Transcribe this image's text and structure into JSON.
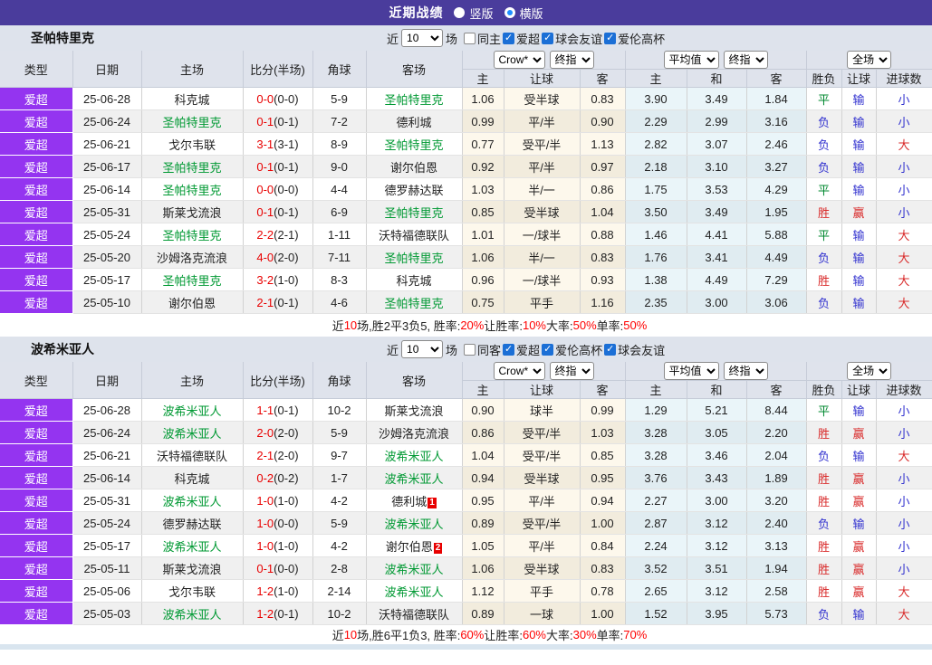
{
  "topbar": {
    "title": "近期战绩",
    "layout_options": [
      {
        "label": "竖版",
        "selected": false
      },
      {
        "label": "横版",
        "selected": true
      }
    ]
  },
  "colors": {
    "topbar": "#4a3c9c",
    "league_badge": "#9434f0",
    "focal_team": "#009933",
    "score_fulltime": "#e80000",
    "win_text": "#d92b2b",
    "draw_text": "#00882f",
    "lose_text": "#3232cf",
    "summary_highlight": "#ff0000",
    "crow_col_bg": "#fdf8ec",
    "avg_col_bg": "#eaf5f9"
  },
  "table_header": {
    "type": "类型",
    "date": "日期",
    "home": "主场",
    "score": "比分(半场)",
    "corner": "角球",
    "away": "客场",
    "crow_select": "Crow*",
    "final_select": "终指",
    "avg_select": "平均值",
    "final_select2": "终指",
    "full_select": "全场",
    "sub_home": "主",
    "sub_handicap": "让球",
    "sub_away": "客",
    "sub_avg_home": "主",
    "sub_draw": "和",
    "sub_avg_away": "客",
    "sub_result": "胜负",
    "sub_handicap_result": "让球",
    "sub_goals": "进球数"
  },
  "sections": [
    {
      "team": "圣帕特里克",
      "controls": {
        "near_label": "近",
        "count": "10",
        "games_label": "场",
        "checkboxes": [
          {
            "label": "同主",
            "checked": false
          },
          {
            "label": "爱超",
            "checked": true
          },
          {
            "label": "球会友谊",
            "checked": true
          },
          {
            "label": "爱伦高杯",
            "checked": true
          }
        ]
      },
      "rows": [
        {
          "league": "爱超",
          "date": "25-06-28",
          "home": "科克城",
          "home_focal": false,
          "score": "0-0",
          "half": "(0-0)",
          "corner": "5-9",
          "away": "圣帕特里克",
          "away_focal": true,
          "crow": [
            "1.06",
            "受半球",
            "0.83"
          ],
          "avg": [
            "3.90",
            "3.49",
            "1.84"
          ],
          "full": [
            "平",
            "输",
            "小"
          ]
        },
        {
          "league": "爱超",
          "date": "25-06-24",
          "home": "圣帕特里克",
          "home_focal": true,
          "score": "0-1",
          "half": "(0-1)",
          "corner": "7-2",
          "away": "德利城",
          "away_focal": false,
          "crow": [
            "0.99",
            "平/半",
            "0.90"
          ],
          "avg": [
            "2.29",
            "2.99",
            "3.16"
          ],
          "full": [
            "负",
            "输",
            "小"
          ]
        },
        {
          "league": "爱超",
          "date": "25-06-21",
          "home": "戈尔韦联",
          "home_focal": false,
          "score": "3-1",
          "half": "(3-1)",
          "corner": "8-9",
          "away": "圣帕特里克",
          "away_focal": true,
          "crow": [
            "0.77",
            "受平/半",
            "1.13"
          ],
          "avg": [
            "2.82",
            "3.07",
            "2.46"
          ],
          "full": [
            "负",
            "输",
            "大"
          ]
        },
        {
          "league": "爱超",
          "date": "25-06-17",
          "home": "圣帕特里克",
          "home_focal": true,
          "score": "0-1",
          "half": "(0-1)",
          "corner": "9-0",
          "away": "谢尔伯恩",
          "away_focal": false,
          "crow": [
            "0.92",
            "平/半",
            "0.97"
          ],
          "avg": [
            "2.18",
            "3.10",
            "3.27"
          ],
          "full": [
            "负",
            "输",
            "小"
          ]
        },
        {
          "league": "爱超",
          "date": "25-06-14",
          "home": "圣帕特里克",
          "home_focal": true,
          "score": "0-0",
          "half": "(0-0)",
          "corner": "4-4",
          "away": "德罗赫达联",
          "away_focal": false,
          "crow": [
            "1.03",
            "半/一",
            "0.86"
          ],
          "avg": [
            "1.75",
            "3.53",
            "4.29"
          ],
          "full": [
            "平",
            "输",
            "小"
          ]
        },
        {
          "league": "爱超",
          "date": "25-05-31",
          "home": "斯莱戈流浪",
          "home_focal": false,
          "score": "0-1",
          "half": "(0-1)",
          "corner": "6-9",
          "away": "圣帕特里克",
          "away_focal": true,
          "crow": [
            "0.85",
            "受半球",
            "1.04"
          ],
          "avg": [
            "3.50",
            "3.49",
            "1.95"
          ],
          "full": [
            "胜",
            "赢",
            "小"
          ]
        },
        {
          "league": "爱超",
          "date": "25-05-24",
          "home": "圣帕特里克",
          "home_focal": true,
          "score": "2-2",
          "half": "(2-1)",
          "corner": "1-11",
          "away": "沃特福德联队",
          "away_focal": false,
          "crow": [
            "1.01",
            "一/球半",
            "0.88"
          ],
          "avg": [
            "1.46",
            "4.41",
            "5.88"
          ],
          "full": [
            "平",
            "输",
            "大"
          ]
        },
        {
          "league": "爱超",
          "date": "25-05-20",
          "home": "沙姆洛克流浪",
          "home_focal": false,
          "score": "4-0",
          "half": "(2-0)",
          "corner": "7-11",
          "away": "圣帕特里克",
          "away_focal": true,
          "crow": [
            "1.06",
            "半/一",
            "0.83"
          ],
          "avg": [
            "1.76",
            "3.41",
            "4.49"
          ],
          "full": [
            "负",
            "输",
            "大"
          ]
        },
        {
          "league": "爱超",
          "date": "25-05-17",
          "home": "圣帕特里克",
          "home_focal": true,
          "score": "3-2",
          "half": "(1-0)",
          "corner": "8-3",
          "away": "科克城",
          "away_focal": false,
          "crow": [
            "0.96",
            "一/球半",
            "0.93"
          ],
          "avg": [
            "1.38",
            "4.49",
            "7.29"
          ],
          "full": [
            "胜",
            "输",
            "大"
          ]
        },
        {
          "league": "爱超",
          "date": "25-05-10",
          "home": "谢尔伯恩",
          "home_focal": false,
          "score": "2-1",
          "half": "(0-1)",
          "corner": "4-6",
          "away": "圣帕特里克",
          "away_focal": true,
          "crow": [
            "0.75",
            "平手",
            "1.16"
          ],
          "avg": [
            "2.35",
            "3.00",
            "3.06"
          ],
          "full": [
            "负",
            "输",
            "大"
          ]
        }
      ],
      "summary": [
        [
          "近",
          0
        ],
        [
          "10",
          1
        ],
        [
          "场,胜2平3负5, 胜率:",
          0
        ],
        [
          "20%",
          1
        ],
        [
          " 让胜率:",
          0
        ],
        [
          "10%",
          1
        ],
        [
          " 大率:",
          0
        ],
        [
          "50%",
          1
        ],
        [
          " 单率:",
          0
        ],
        [
          "50%",
          1
        ]
      ]
    },
    {
      "team": "波希米亚人",
      "controls": {
        "near_label": "近",
        "count": "10",
        "games_label": "场",
        "checkboxes": [
          {
            "label": "同客",
            "checked": false
          },
          {
            "label": "爱超",
            "checked": true
          },
          {
            "label": "爱伦高杯",
            "checked": true
          },
          {
            "label": "球会友谊",
            "checked": true
          }
        ]
      },
      "rows": [
        {
          "league": "爱超",
          "date": "25-06-28",
          "home": "波希米亚人",
          "home_focal": true,
          "score": "1-1",
          "half": "(0-1)",
          "corner": "10-2",
          "away": "斯莱戈流浪",
          "away_focal": false,
          "crow": [
            "0.90",
            "球半",
            "0.99"
          ],
          "avg": [
            "1.29",
            "5.21",
            "8.44"
          ],
          "full": [
            "平",
            "输",
            "小"
          ]
        },
        {
          "league": "爱超",
          "date": "25-06-24",
          "home": "波希米亚人",
          "home_focal": true,
          "score": "2-0",
          "half": "(2-0)",
          "corner": "5-9",
          "away": "沙姆洛克流浪",
          "away_focal": false,
          "crow": [
            "0.86",
            "受平/半",
            "1.03"
          ],
          "avg": [
            "3.28",
            "3.05",
            "2.20"
          ],
          "full": [
            "胜",
            "赢",
            "小"
          ]
        },
        {
          "league": "爱超",
          "date": "25-06-21",
          "home": "沃特福德联队",
          "home_focal": false,
          "score": "2-1",
          "half": "(2-0)",
          "corner": "9-7",
          "away": "波希米亚人",
          "away_focal": true,
          "crow": [
            "1.04",
            "受平/半",
            "0.85"
          ],
          "avg": [
            "3.28",
            "3.46",
            "2.04"
          ],
          "full": [
            "负",
            "输",
            "大"
          ]
        },
        {
          "league": "爱超",
          "date": "25-06-14",
          "home": "科克城",
          "home_focal": false,
          "score": "0-2",
          "half": "(0-2)",
          "corner": "1-7",
          "away": "波希米亚人",
          "away_focal": true,
          "crow": [
            "0.94",
            "受半球",
            "0.95"
          ],
          "avg": [
            "3.76",
            "3.43",
            "1.89"
          ],
          "full": [
            "胜",
            "赢",
            "小"
          ]
        },
        {
          "league": "爱超",
          "date": "25-05-31",
          "home": "波希米亚人",
          "home_focal": true,
          "score": "1-0",
          "half": "(1-0)",
          "corner": "4-2",
          "away": "德利城",
          "away_focal": false,
          "away_badge": "1",
          "crow": [
            "0.95",
            "平/半",
            "0.94"
          ],
          "avg": [
            "2.27",
            "3.00",
            "3.20"
          ],
          "full": [
            "胜",
            "赢",
            "小"
          ]
        },
        {
          "league": "爱超",
          "date": "25-05-24",
          "home": "德罗赫达联",
          "home_focal": false,
          "score": "1-0",
          "half": "(0-0)",
          "corner": "5-9",
          "away": "波希米亚人",
          "away_focal": true,
          "crow": [
            "0.89",
            "受平/半",
            "1.00"
          ],
          "avg": [
            "2.87",
            "3.12",
            "2.40"
          ],
          "full": [
            "负",
            "输",
            "小"
          ]
        },
        {
          "league": "爱超",
          "date": "25-05-17",
          "home": "波希米亚人",
          "home_focal": true,
          "score": "1-0",
          "half": "(1-0)",
          "corner": "4-2",
          "away": "谢尔伯恩",
          "away_focal": false,
          "away_badge": "2",
          "crow": [
            "1.05",
            "平/半",
            "0.84"
          ],
          "avg": [
            "2.24",
            "3.12",
            "3.13"
          ],
          "full": [
            "胜",
            "赢",
            "小"
          ]
        },
        {
          "league": "爱超",
          "date": "25-05-11",
          "home": "斯莱戈流浪",
          "home_focal": false,
          "score": "0-1",
          "half": "(0-0)",
          "corner": "2-8",
          "away": "波希米亚人",
          "away_focal": true,
          "crow": [
            "1.06",
            "受半球",
            "0.83"
          ],
          "avg": [
            "3.52",
            "3.51",
            "1.94"
          ],
          "full": [
            "胜",
            "赢",
            "小"
          ]
        },
        {
          "league": "爱超",
          "date": "25-05-06",
          "home": "戈尔韦联",
          "home_focal": false,
          "score": "1-2",
          "half": "(1-0)",
          "corner": "2-14",
          "away": "波希米亚人",
          "away_focal": true,
          "crow": [
            "1.12",
            "平手",
            "0.78"
          ],
          "avg": [
            "2.65",
            "3.12",
            "2.58"
          ],
          "full": [
            "胜",
            "赢",
            "大"
          ]
        },
        {
          "league": "爱超",
          "date": "25-05-03",
          "home": "波希米亚人",
          "home_focal": true,
          "score": "1-2",
          "half": "(0-1)",
          "corner": "10-2",
          "away": "沃特福德联队",
          "away_focal": false,
          "crow": [
            "0.89",
            "一球",
            "1.00"
          ],
          "avg": [
            "1.52",
            "3.95",
            "5.73"
          ],
          "full": [
            "负",
            "输",
            "大"
          ]
        }
      ],
      "summary": [
        [
          "近",
          0
        ],
        [
          "10",
          1
        ],
        [
          "场,胜6平1负3, 胜率:",
          0
        ],
        [
          "60%",
          1
        ],
        [
          " 让胜率:",
          0
        ],
        [
          "60%",
          1
        ],
        [
          " 大率:",
          0
        ],
        [
          "30%",
          1
        ],
        [
          " 单率:",
          0
        ],
        [
          "70%",
          1
        ]
      ]
    }
  ]
}
